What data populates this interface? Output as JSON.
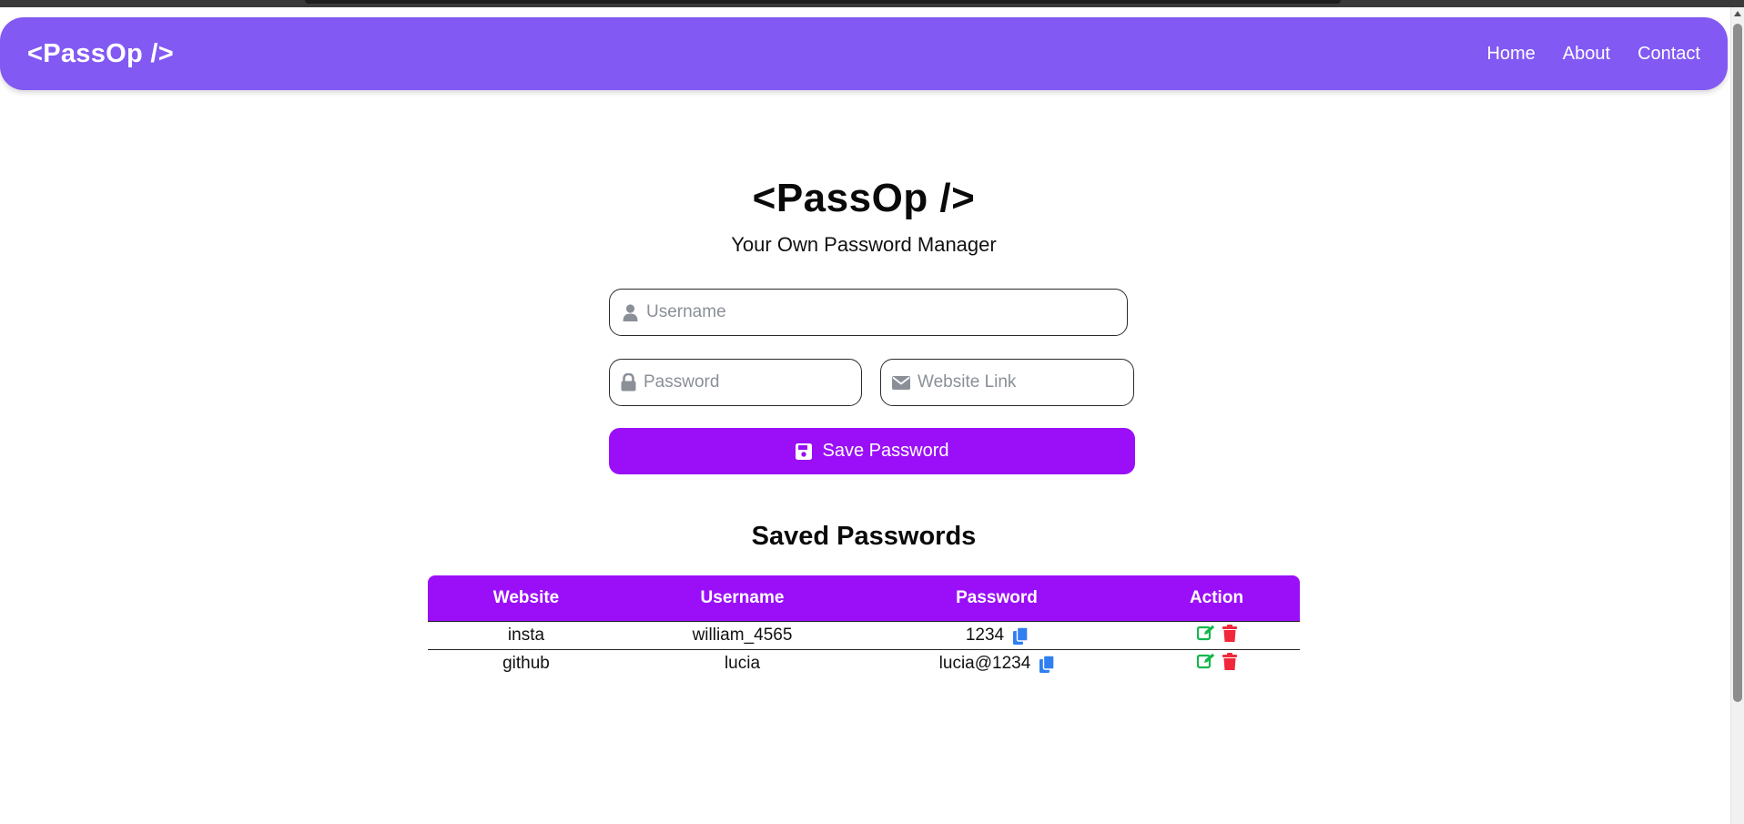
{
  "navbar": {
    "logo": "<PassOp />",
    "links": [
      "Home",
      "About",
      "Contact"
    ]
  },
  "hero": {
    "title": "<PassOp />",
    "subtitle": "Your Own Password Manager"
  },
  "form": {
    "username_placeholder": "Username",
    "password_placeholder": "Password",
    "website_placeholder": "Website Link",
    "save_label": "Save Password"
  },
  "saved": {
    "title": "Saved Passwords",
    "columns": [
      "Website",
      "Username",
      "Password",
      "Action"
    ],
    "rows": [
      {
        "website": "insta",
        "username": "william_4565",
        "password": "1234"
      },
      {
        "website": "github",
        "username": "lucia",
        "password": "lucia@1234"
      }
    ]
  },
  "colors": {
    "navbar": "#8259f3",
    "accent": "#9a0ff7",
    "copy_icon": "#2f7ff0",
    "edit_icon": "#12b84a",
    "delete_icon": "#f0283a"
  },
  "icons": {
    "username": "user-icon",
    "password": "lock-icon",
    "website": "envelope-icon",
    "save": "floppy-disk-icon",
    "copy": "copy-icon",
    "edit": "edit-icon",
    "delete": "trash-icon"
  }
}
